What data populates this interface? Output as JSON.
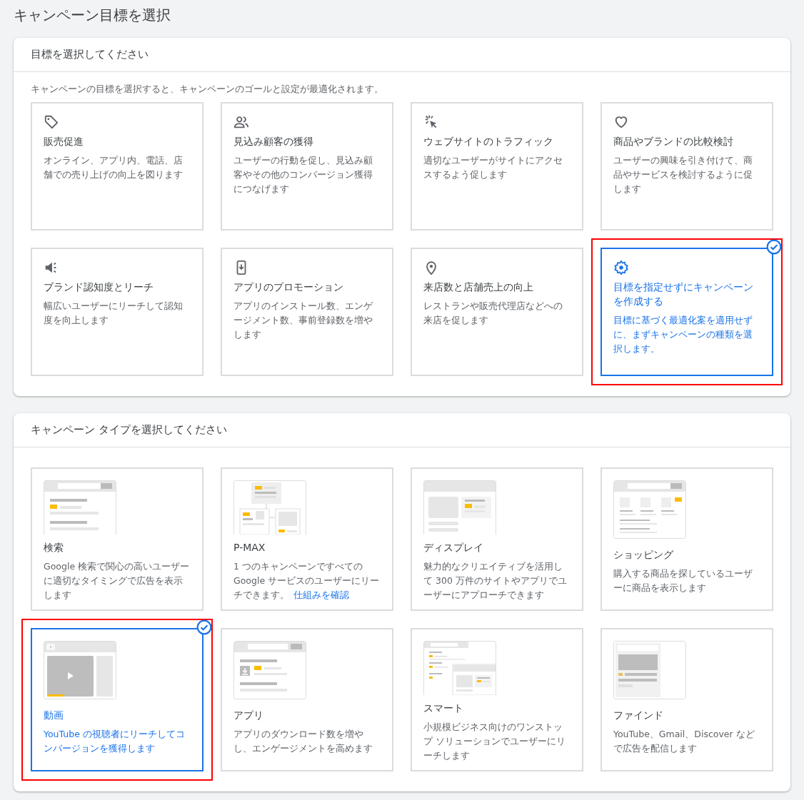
{
  "page_title": "キャンペーン目標を選択",
  "goal_section": {
    "title": "目標を選択してください",
    "intro": "キャンペーンの目標を選択すると、キャンペーンのゴールと設定が最適化されます。",
    "goals": [
      {
        "kind": "tag",
        "title": "販売促進",
        "description": "オンライン、アプリ内、電話、店舗での売り上げの向上を図ります",
        "selected": false
      },
      {
        "kind": "people",
        "title": "見込み顧客の獲得",
        "description": "ユーザーの行動を促し、見込み顧客やその他のコンバージョン獲得につなげます",
        "selected": false
      },
      {
        "kind": "click",
        "title": "ウェブサイトのトラフィック",
        "description": "適切なユーザーがサイトにアクセスするよう促します",
        "selected": false
      },
      {
        "kind": "heart",
        "title": "商品やブランドの比較検討",
        "description": "ユーザーの興味を引き付けて、商品やサービスを検討するように促します",
        "selected": false
      },
      {
        "kind": "megaphone",
        "title": "ブランド認知度とリーチ",
        "description": "幅広いユーザーにリーチして認知度を向上します",
        "selected": false
      },
      {
        "kind": "phone",
        "title": "アプリのプロモーション",
        "description": "アプリのインストール数、エンゲージメント数、事前登録数を増やします",
        "selected": false
      },
      {
        "kind": "pin",
        "title": "来店数と店舗売上の向上",
        "description": "レストランや販売代理店などへの来店を促します",
        "selected": false
      },
      {
        "kind": "gear",
        "title": "目標を指定せずにキャンペーンを作成する",
        "description": "目標に基づく最適化案を適用せずに、まずキャンペーンの種類を選択します。",
        "selected": true
      }
    ]
  },
  "type_section": {
    "title": "キャンペーン タイプを選択してください",
    "types": [
      {
        "kind": "search",
        "title": "検索",
        "description": "Google 検索で関心の高いユーザーに適切なタイミングで広告を表示します",
        "selected": false
      },
      {
        "kind": "pmax",
        "title": "P-MAX",
        "description": "1 つのキャンペーンですべての Google サービスのユーザーにリーチできます。",
        "link": "仕組みを確認",
        "selected": false
      },
      {
        "kind": "display",
        "title": "ディスプレイ",
        "description": "魅力的なクリエイティブを活用して 300 万件のサイトやアプリでユーザーにアプローチできます",
        "selected": false
      },
      {
        "kind": "shopping",
        "title": "ショッピング",
        "description": "購入する商品を探しているユーザーに商品を表示します",
        "selected": false
      },
      {
        "kind": "video",
        "title": "動画",
        "description": "YouTube の視聴者にリーチしてコンバージョンを獲得します",
        "selected": true
      },
      {
        "kind": "app",
        "title": "アプリ",
        "description": "アプリのダウンロード数を増やし、エンゲージメントを高めます",
        "selected": false
      },
      {
        "kind": "smart",
        "title": "スマート",
        "description": "小規模ビジネス向けのワンストップ ソリューションでユーザーにリーチします",
        "selected": false
      },
      {
        "kind": "discover",
        "title": "ファインド",
        "description": "YouTube、Gmail、Discover などで広告を配信します",
        "selected": false
      }
    ]
  }
}
